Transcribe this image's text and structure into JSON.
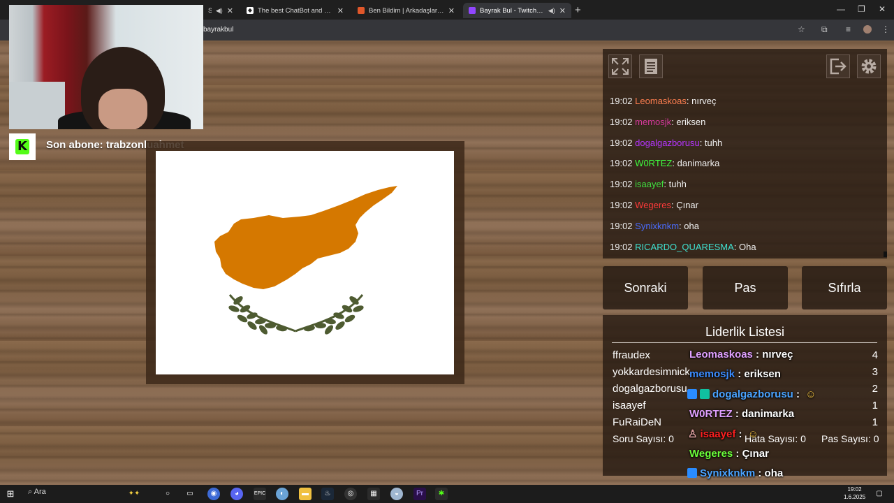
{
  "browser": {
    "tabs": [
      {
        "label": "So",
        "favicon_color": "#8a8a8a"
      },
      {
        "label": "The best ChatBot and Widgets",
        "favicon_color": "#ffffff"
      },
      {
        "label": "Ben Bildim | Arkadaşlarınla Onl",
        "favicon_color": "#e0572a"
      },
      {
        "label": "Bayrak Bul - Twitch Stream",
        "favicon_color": "#9146ff",
        "active": true
      }
    ],
    "url": "bayrakbul"
  },
  "sub_alert": {
    "text": "Son abone: trabzonluahmet",
    "brand_color": "#53fc18"
  },
  "chat": {
    "messages": [
      {
        "time": "19:02",
        "user": "Leomaskoas",
        "text": ": nırveç",
        "color": "#ff7f50"
      },
      {
        "time": "19:02",
        "user": "memosjk",
        "text": ": eriksen",
        "color": "#d4399b"
      },
      {
        "time": "19:02",
        "user": "dogalgazborusu",
        "text": ": tuhh",
        "color": "#b433ff"
      },
      {
        "time": "19:02",
        "user": "W0RTEZ",
        "text": ": danimarka",
        "color": "#3fff3f"
      },
      {
        "time": "19:02",
        "user": "isaayef",
        "text": ": tuhh",
        "color": "#40e040"
      },
      {
        "time": "19:02",
        "user": "Wegeres",
        "text": ": Çınar",
        "color": "#ff3a3a"
      },
      {
        "time": "19:02",
        "user": "Synixknkm",
        "text": ": oha",
        "color": "#4a6cff"
      },
      {
        "time": "19:02",
        "user": "RICARDO_QUARESMA",
        "text": ": Oha",
        "color": "#3fe0d0"
      }
    ]
  },
  "controls": {
    "next_label": "Sonraki",
    "pass_label": "Pas",
    "reset_label": "Sıfırla"
  },
  "leaderboard": {
    "title": "Liderlik Listesi",
    "rows": [
      {
        "name": "ffraudex",
        "score": "4"
      },
      {
        "name": "yokkardesimnick",
        "score": "3"
      },
      {
        "name": "dogalgazborusu",
        "score": "2"
      },
      {
        "name": "isaayef",
        "score": "1"
      },
      {
        "name": "FuRaiDeN",
        "score": "1"
      }
    ],
    "question_count": "Soru Sayısı: 0",
    "error_count": "Hata Sayısı: 0",
    "pass_count": "Pas Sayısı: 0"
  },
  "overlay_chat": [
    {
      "user": "Leomaskoas",
      "text": " : nırveç",
      "color": "#e0a0ff"
    },
    {
      "user": "memosjk",
      "text": " : eriksen",
      "color": "#3b8cff"
    },
    {
      "user": "dogalgazborusu",
      "text": " : ",
      "color": "#4aa3ff"
    },
    {
      "user": "W0RTEZ",
      "text": " : danimarka",
      "color": "#e0a0ff"
    },
    {
      "user": "isaayef",
      "text": " : ",
      "color": "#ff2020"
    },
    {
      "user": "Wegeres",
      "text": " : Çınar",
      "color": "#6cff3a"
    },
    {
      "user": "Synixknkm",
      "text": " : oha",
      "color": "#4aa3ff"
    },
    {
      "user": "RICARDO_QUARESMA",
      "text": " : Oha",
      "color": "#ff2040"
    }
  ],
  "taskbar": {
    "search_placeholder": "Ara",
    "time": "19:02",
    "date": "1.6.2025"
  },
  "flag": {
    "map_color": "#d57800",
    "branch_color": "#4e5b31"
  }
}
